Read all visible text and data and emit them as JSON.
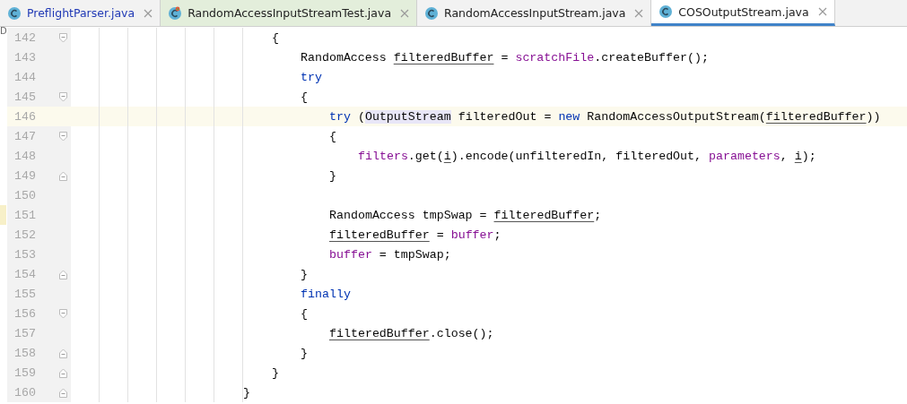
{
  "tabs": [
    {
      "label": "PreflightParser.java",
      "kind": "class",
      "selected": false,
      "modified": true
    },
    {
      "label": "RandomAccessInputStreamTest.java",
      "kind": "test",
      "selected": false,
      "modified": false
    },
    {
      "label": "RandomAccessInputStream.java",
      "kind": "class",
      "selected": false,
      "modified": false
    },
    {
      "label": "COSOutputStream.java",
      "kind": "class",
      "selected": true,
      "modified": false
    }
  ],
  "gutter_mark": "D",
  "lines": [
    {
      "children": [
        {
          "number": "142",
          "fold": {
            "kind": "start"
          },
          "current": false,
          "changed": false,
          "tokens": [
            {
              "t": "{"
            }
          ]
        },
        {
          "children": [
            {
              "number": "143",
              "current": false,
              "changed": false,
              "tokens": [
                {
                  "t": "RandomAccess "
                },
                {
                  "t": "filteredBuffer",
                  "kind": "var"
                },
                {
                  "t": " = "
                },
                {
                  "t": "scratchFile",
                  "kind": "field"
                },
                {
                  "t": ".createBuffer();"
                }
              ]
            },
            {
              "number": "144",
              "current": false,
              "changed": false,
              "tokens": [
                {
                  "t": "try",
                  "kind": "kw"
                }
              ]
            },
            {
              "number": "145",
              "fold": {
                "kind": "start"
              },
              "current": false,
              "changed": false,
              "tokens": [
                {
                  "t": "{"
                }
              ]
            },
            {
              "children": [
                {
                  "number": "146",
                  "current": true,
                  "changed": false,
                  "tokens": [
                    {
                      "t": "try",
                      "kind": "kw"
                    },
                    {
                      "t": " ("
                    },
                    {
                      "t": "OutputStream",
                      "kind": "hl"
                    },
                    {
                      "t": " filteredOut = "
                    },
                    {
                      "t": "new",
                      "kind": "kw"
                    },
                    {
                      "t": " RandomAccessOutputStream("
                    },
                    {
                      "t": "filteredBuffer",
                      "kind": "var"
                    },
                    {
                      "t": "))"
                    }
                  ]
                },
                {
                  "number": "147",
                  "fold": {
                    "kind": "start"
                  },
                  "current": false,
                  "changed": false,
                  "tokens": [
                    {
                      "t": "{"
                    }
                  ]
                },
                {
                  "children": [
                    {
                      "number": "148",
                      "current": false,
                      "changed": false,
                      "tokens": [
                        {
                          "t": "filters",
                          "kind": "field"
                        },
                        {
                          "t": ".get("
                        },
                        {
                          "t": "i",
                          "kind": "var"
                        },
                        {
                          "t": ").encode(unfilteredIn, filteredOut, "
                        },
                        {
                          "t": "parameters",
                          "kind": "field"
                        },
                        {
                          "t": ", "
                        },
                        {
                          "t": "i",
                          "kind": "var"
                        },
                        {
                          "t": ");"
                        }
                      ]
                    }
                  ]
                },
                {
                  "number": "149",
                  "fold": {
                    "kind": "end"
                  },
                  "current": false,
                  "changed": false,
                  "tokens": [
                    {
                      "t": "}"
                    }
                  ]
                },
                {
                  "number": "150",
                  "current": false,
                  "changed": false
                },
                {
                  "number": "151",
                  "current": false,
                  "changed": true,
                  "tokens": [
                    {
                      "t": "RandomAccess tmpSwap = "
                    },
                    {
                      "t": "filteredBuffer",
                      "kind": "var"
                    },
                    {
                      "t": ";"
                    }
                  ]
                },
                {
                  "number": "152",
                  "current": false,
                  "changed": false,
                  "tokens": [
                    {
                      "t": "filteredBuffer",
                      "kind": "var"
                    },
                    {
                      "t": " = "
                    },
                    {
                      "t": "buffer",
                      "kind": "field"
                    },
                    {
                      "t": ";"
                    }
                  ]
                },
                {
                  "number": "153",
                  "current": false,
                  "changed": false,
                  "tokens": [
                    {
                      "t": "buffer",
                      "kind": "field"
                    },
                    {
                      "t": " = tmpSwap;"
                    }
                  ]
                }
              ]
            },
            {
              "number": "154",
              "fold": {
                "kind": "end"
              },
              "current": false,
              "changed": false,
              "tokens": [
                {
                  "t": "}"
                }
              ]
            },
            {
              "number": "155",
              "current": false,
              "changed": false,
              "tokens": [
                {
                  "t": "finally",
                  "kind": "kw"
                }
              ]
            },
            {
              "number": "156",
              "fold": {
                "kind": "start"
              },
              "current": false,
              "changed": false,
              "tokens": [
                {
                  "t": "{"
                }
              ]
            },
            {
              "children": [
                {
                  "number": "157",
                  "current": false,
                  "changed": false,
                  "tokens": [
                    {
                      "t": "filteredBuffer",
                      "kind": "var"
                    },
                    {
                      "t": ".close();"
                    }
                  ]
                }
              ]
            },
            {
              "number": "158",
              "fold": {
                "kind": "end"
              },
              "current": false,
              "changed": false,
              "tokens": [
                {
                  "t": "}"
                }
              ]
            }
          ]
        },
        {
          "number": "159",
          "fold": {
            "kind": "end"
          },
          "current": false,
          "changed": false,
          "tokens": [
            {
              "t": "}"
            }
          ]
        }
      ]
    },
    {
      "number": "160",
      "fold": {
        "kind": "end"
      },
      "current": false,
      "changed": false,
      "tokens": [
        {
          "t": "}"
        }
      ]
    }
  ]
}
